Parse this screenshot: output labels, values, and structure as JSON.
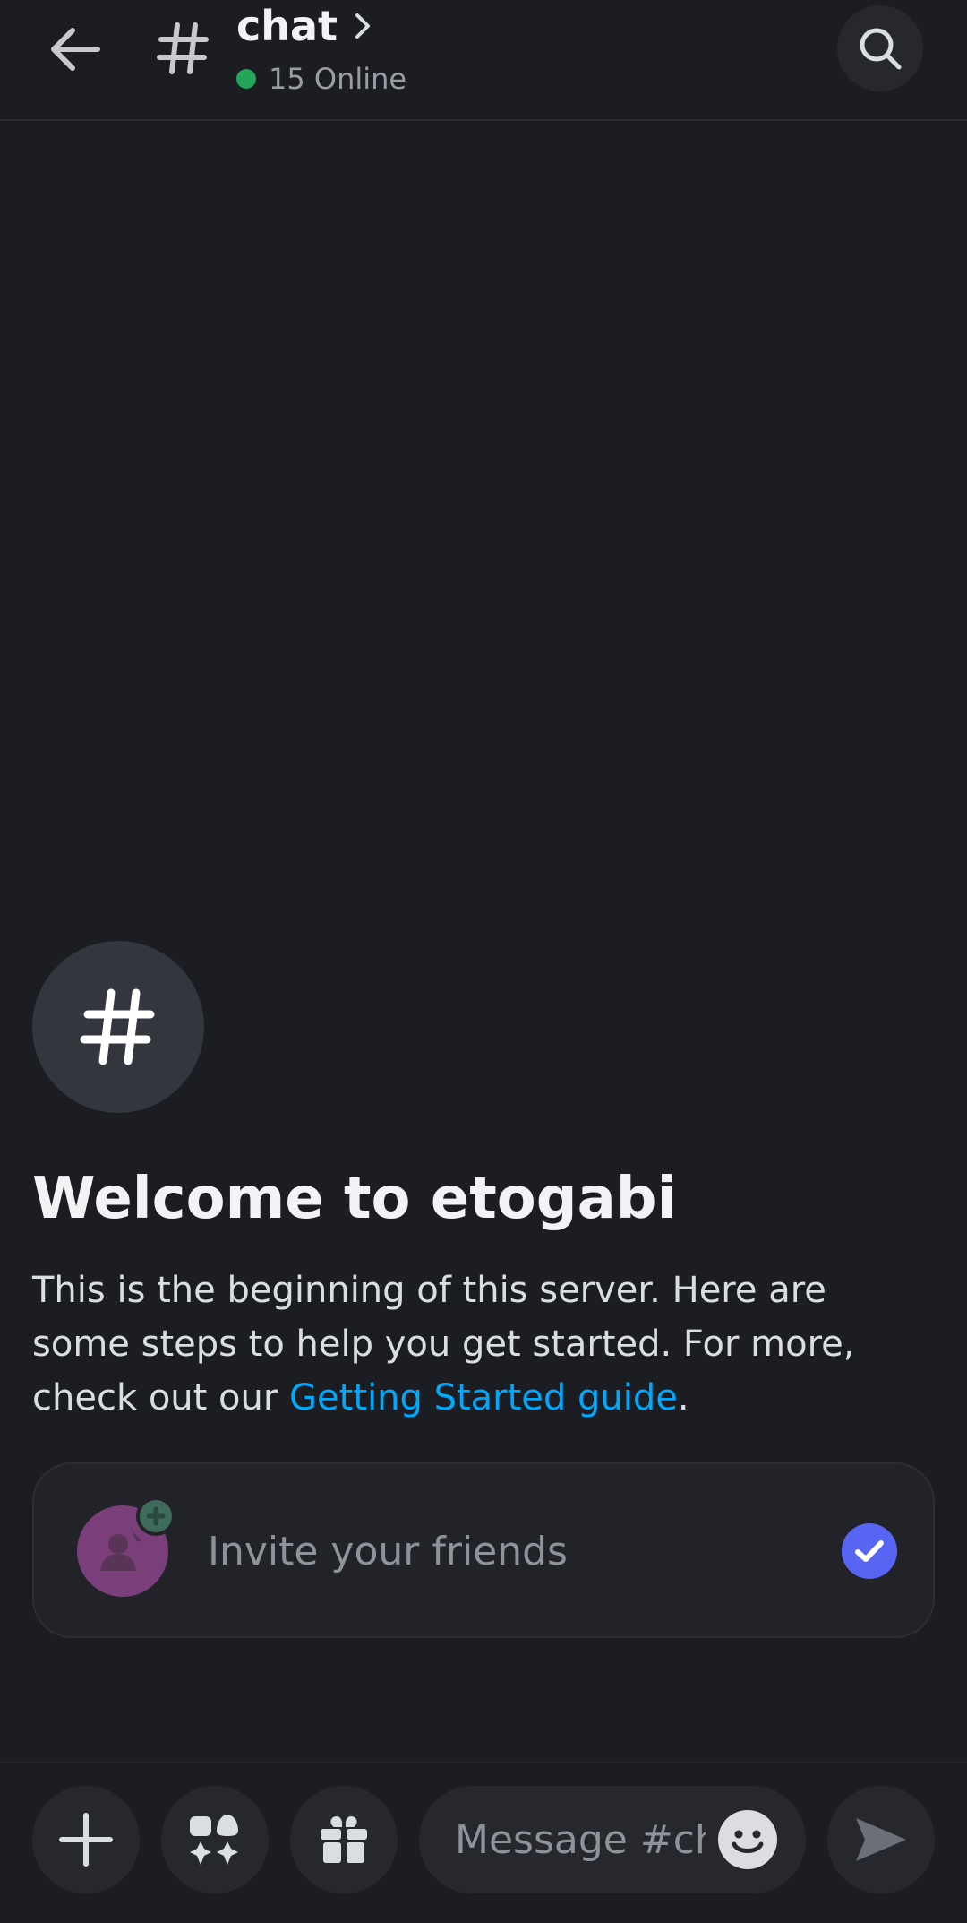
{
  "header": {
    "channel_name": "chat",
    "online_count": "15 Online",
    "icons": {
      "back": "arrow-left-icon",
      "channel": "hash-icon",
      "chevron": "chevron-right-icon",
      "search": "search-icon"
    }
  },
  "welcome": {
    "title": "Welcome to etogabi",
    "body_text": "This is the beginning of this server. Here are some steps to help you get started. For more, check out our ",
    "link_text": "Getting Started guide",
    "body_end": "."
  },
  "steps": [
    {
      "label": "Invite your friends",
      "completed": true
    }
  ],
  "composer": {
    "placeholder": "Message #chat",
    "buttons": {
      "plus": "plus-icon",
      "apps": "apps-icon",
      "gift": "gift-icon",
      "emoji": "emoji-icon",
      "send": "send-icon"
    }
  },
  "colors": {
    "background": "#1c1d22",
    "online_status": "#23a55a",
    "link": "#00a8fc",
    "brand_check": "#5865f2"
  }
}
